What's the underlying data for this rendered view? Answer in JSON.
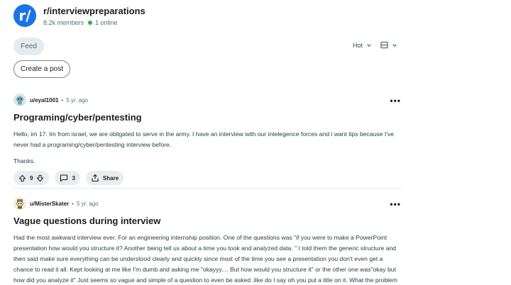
{
  "community": {
    "avatar_glyph": "r/",
    "name": "r/interviewpreparations",
    "members": "8.2k members",
    "online": "1 online"
  },
  "feed": {
    "tab_label": "Feed",
    "sort_label": "Hot",
    "create_post_label": "Create a post"
  },
  "posts": [
    {
      "username": "u/eyal1001",
      "separator": "•",
      "age": "5 yr. ago",
      "title": "Programing/cyber/pentesting",
      "body": [
        "Hello, im 17. Im from israel, we are obligated to serve in the army. I have an interview with our intelegence forces and i want tips because I've never had a programing/cyber/pentesting interview before.",
        "Thanks."
      ],
      "votes": "9",
      "comments": "3",
      "share_label": "Share",
      "more": "•••"
    },
    {
      "username": "u/MisterSkater",
      "separator": "•",
      "age": "5 yr. ago",
      "title": "Vague questions during interview",
      "body": [
        "Had the most awkward interview ever. For an engineering internship position. One of the questions was \"if you were to make a PowerPoint presentation how would you structure it? Another being tell us about a time you took and analyzed data. \" I told them the generic structure and then said make sure everything can be understood clearly and quickly since most of the time you see a presentation you don't even get a chance to read it all. Kept looking at me like I'm dumb and asking me \"okayyy.... But how would you structure it\" or the other one was\"okay but how did you analyze it\" Just seems so vague and simple of a question to even be asked .like do I say oh you put a title on it. What the problem is. Generic organization of logical events? Ultimately the"
      ],
      "more": "•••"
    }
  ],
  "colors": {
    "brand": "#1a73e8",
    "online": "#2bb14a",
    "pill_bg": "#eaedef"
  }
}
